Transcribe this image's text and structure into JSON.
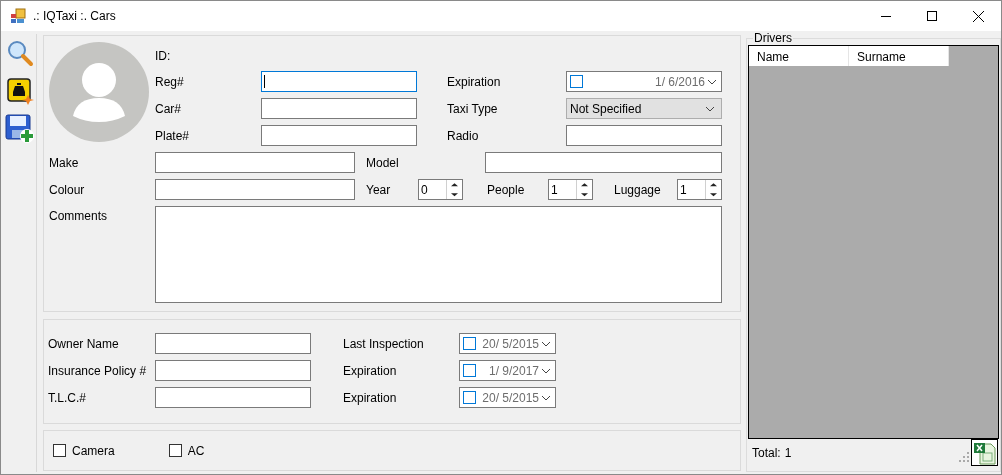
{
  "window": {
    "title": ".: IQTaxi :. Cars"
  },
  "car": {
    "id_label": "ID:",
    "left_fields": [
      {
        "label": "Reg#",
        "focused": true
      },
      {
        "label": "Car#",
        "focused": false
      },
      {
        "label": "Plate#",
        "focused": false
      }
    ],
    "expiration": {
      "label": "Expiration",
      "value": "1/ 6/2016",
      "checked": false
    },
    "taxi_type": {
      "label": "Taxi Type",
      "value": "Not Specified"
    },
    "radio": {
      "label": "Radio"
    },
    "make": {
      "label": "Make"
    },
    "model": {
      "label": "Model"
    },
    "colour": {
      "label": "Colour"
    },
    "spinners": [
      {
        "label": "Year",
        "value": "0"
      },
      {
        "label": "People",
        "value": "1"
      },
      {
        "label": "Luggage",
        "value": "1"
      }
    ],
    "comments": {
      "label": "Comments"
    }
  },
  "owner": {
    "fields": [
      {
        "label": "Owner Name"
      },
      {
        "label": "Insurance Policy #"
      },
      {
        "label": "T.L.C.#"
      }
    ],
    "dates": [
      {
        "label": "Last Inspection",
        "value": "20/ 5/2015",
        "checked": false
      },
      {
        "label": "Expiration",
        "value": "1/ 9/2017",
        "checked": false
      },
      {
        "label": "Expiration",
        "value": "20/ 5/2015",
        "checked": false
      }
    ]
  },
  "options": [
    {
      "label": "Camera",
      "checked": false
    },
    {
      "label": "AC",
      "checked": false
    }
  ],
  "drivers": {
    "title": "Drivers",
    "columns": [
      "Name",
      "Surname"
    ],
    "total_label": "Total:",
    "total": "1"
  }
}
